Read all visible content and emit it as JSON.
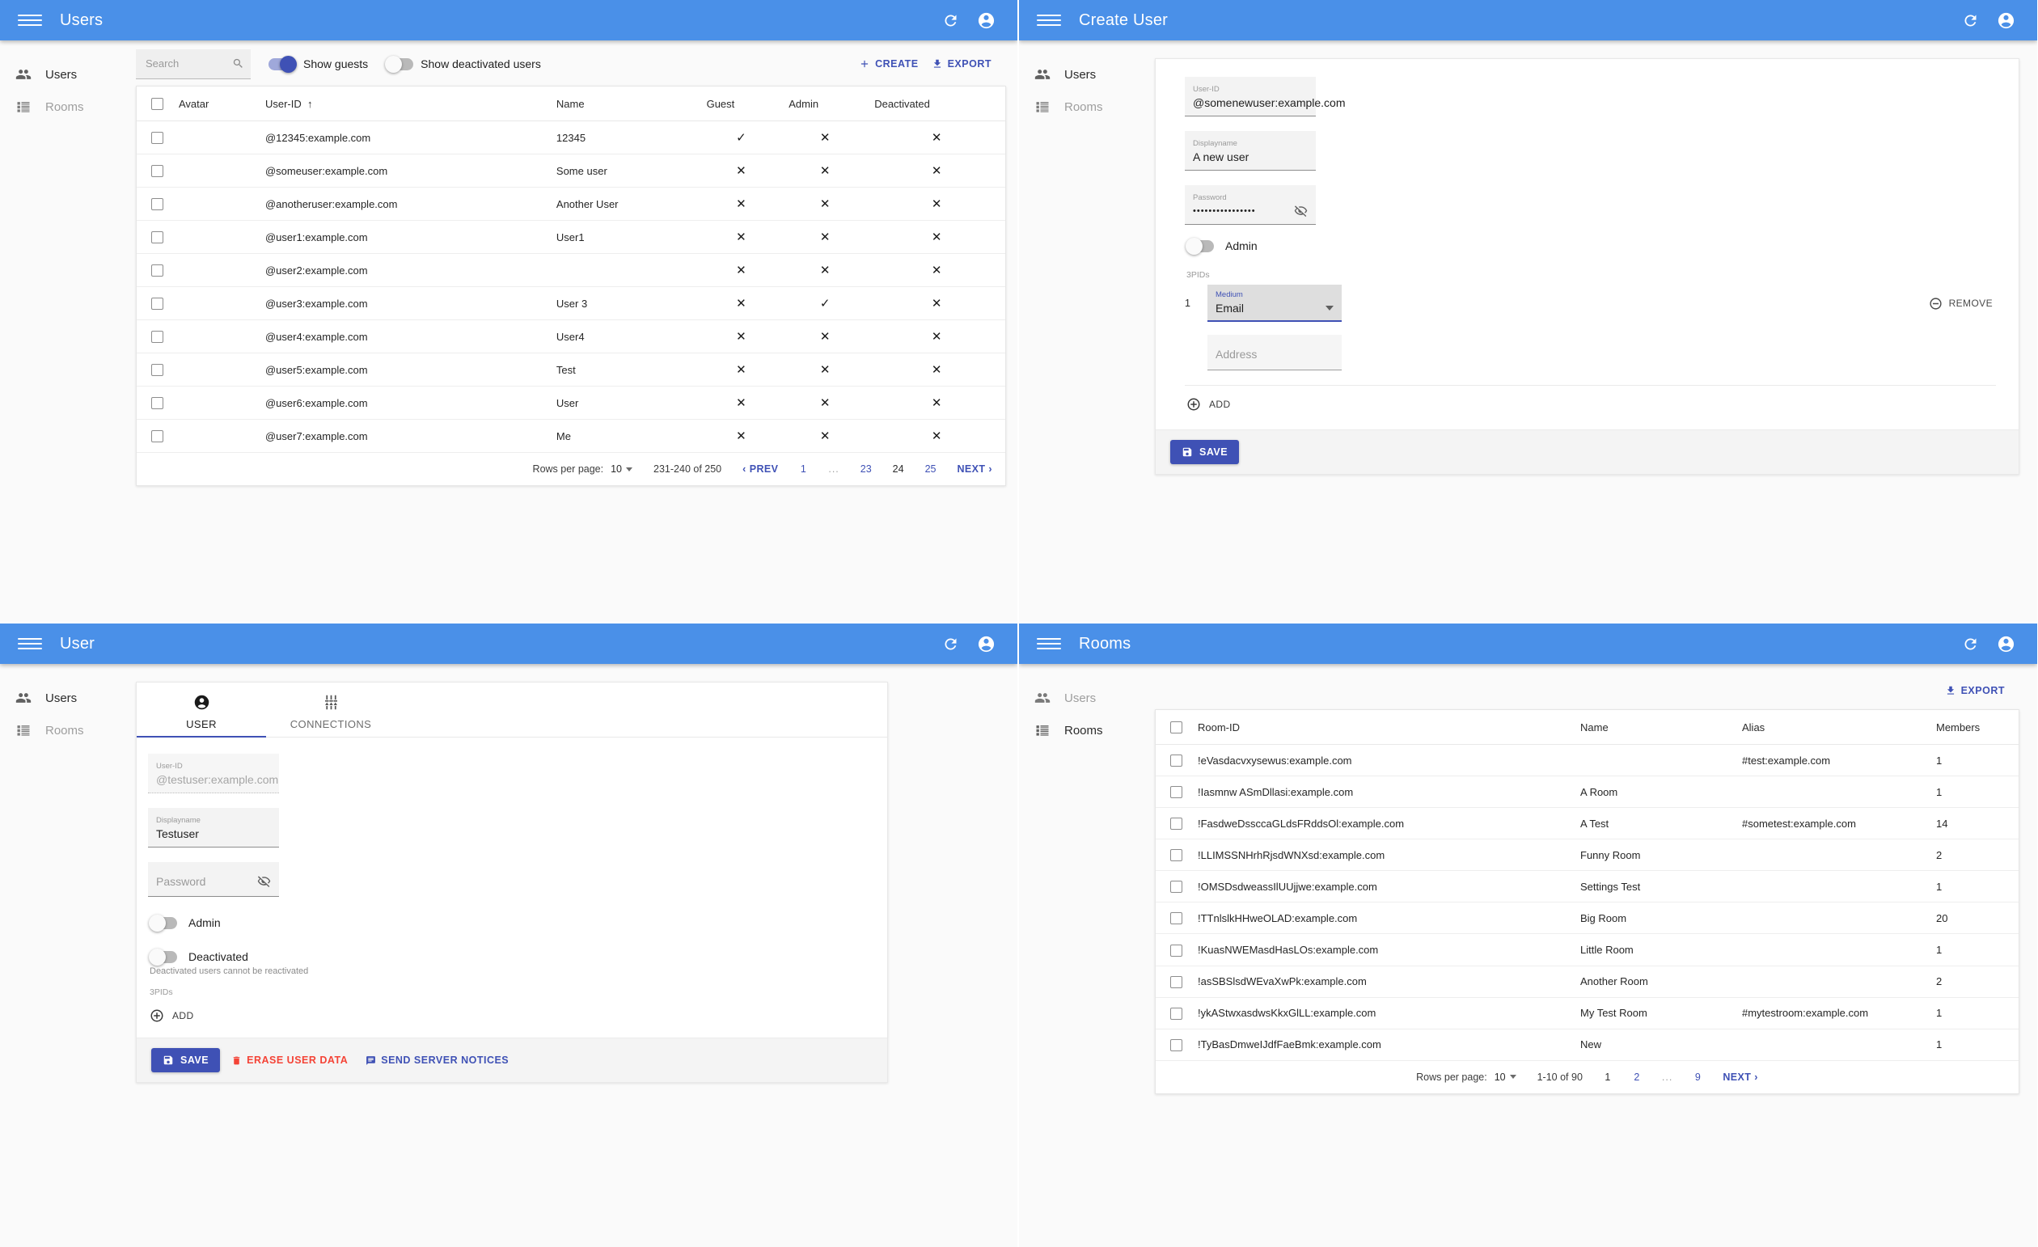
{
  "theme": {
    "appbar": "#4a90e8",
    "accent": "#3f51b5",
    "danger": "#f44336"
  },
  "panels": {
    "users_list": {
      "title": "Users",
      "sidebar": [
        {
          "label": "Users",
          "icon": "people-icon",
          "active": true
        },
        {
          "label": "Rooms",
          "icon": "list-icon",
          "active": false
        }
      ],
      "toolbar": {
        "search_placeholder": "Search",
        "search_value": "",
        "show_guests_label": "Show guests",
        "show_guests_on": true,
        "show_deactivated_label": "Show deactivated users",
        "show_deactivated_on": false,
        "create_label": "CREATE",
        "export_label": "EXPORT"
      },
      "table": {
        "columns": [
          "Avatar",
          "User-ID",
          "Name",
          "Guest",
          "Admin",
          "Deactivated"
        ],
        "sort_column": "User-ID",
        "sort_dir": "asc",
        "rows": [
          {
            "user_id": "@12345:example.com",
            "name": "12345",
            "guest": "check",
            "admin": "cross",
            "deactivated": "cross"
          },
          {
            "user_id": "@someuser:example.com",
            "name": "Some user",
            "guest": "cross",
            "admin": "cross",
            "deactivated": "cross"
          },
          {
            "user_id": "@anotheruser:example.com",
            "name": "Another User",
            "guest": "cross",
            "admin": "cross",
            "deactivated": "cross"
          },
          {
            "user_id": "@user1:example.com",
            "name": "User1",
            "guest": "cross",
            "admin": "cross",
            "deactivated": "cross"
          },
          {
            "user_id": "@user2:example.com",
            "name": "",
            "guest": "cross",
            "admin": "cross",
            "deactivated": "cross"
          },
          {
            "user_id": "@user3:example.com",
            "name": "User 3",
            "guest": "cross",
            "admin": "check",
            "deactivated": "cross"
          },
          {
            "user_id": "@user4:example.com",
            "name": "User4",
            "guest": "cross",
            "admin": "cross",
            "deactivated": "cross"
          },
          {
            "user_id": "@user5:example.com",
            "name": "Test",
            "guest": "cross",
            "admin": "cross",
            "deactivated": "cross"
          },
          {
            "user_id": "@user6:example.com",
            "name": "User",
            "guest": "cross",
            "admin": "cross",
            "deactivated": "cross"
          },
          {
            "user_id": "@user7:example.com",
            "name": "Me",
            "guest": "cross",
            "admin": "cross",
            "deactivated": "cross"
          }
        ]
      },
      "pagination": {
        "rows_per_page_label": "Rows per page:",
        "rows_per_page_value": "10",
        "range": "231-240 of 250",
        "prev_label": "PREV",
        "next_label": "NEXT",
        "pages": [
          {
            "label": "1",
            "current": false
          },
          {
            "label": "...",
            "current": false,
            "dots": true
          },
          {
            "label": "23",
            "current": false
          },
          {
            "label": "24",
            "current": true
          },
          {
            "label": "25",
            "current": false
          }
        ]
      }
    },
    "create_user": {
      "title": "Create User",
      "sidebar": [
        {
          "label": "Users",
          "icon": "people-icon",
          "active": true
        },
        {
          "label": "Rooms",
          "icon": "list-icon",
          "active": false
        }
      ],
      "form": {
        "user_id_label": "User-ID",
        "user_id_value": "@somenewuser:example.com",
        "displayname_label": "Displayname",
        "displayname_value": "A new user",
        "password_label": "Password",
        "password_value": "••••••••••••••••",
        "password_toggle_icon": "eye-off-icon",
        "admin_label": "Admin",
        "admin_on": false,
        "threepids_label": "3PIDs",
        "pid_index": "1",
        "medium_label": "Medium",
        "medium_value": "Email",
        "address_placeholder": "Address",
        "address_value": "",
        "remove_label": "REMOVE",
        "add_label": "ADD",
        "save_label": "SAVE"
      }
    },
    "user_detail": {
      "title": "User",
      "sidebar": [
        {
          "label": "Users",
          "icon": "people-icon",
          "active": true
        },
        {
          "label": "Rooms",
          "icon": "list-icon",
          "active": false
        }
      ],
      "tabs": [
        {
          "label": "USER",
          "icon": "account-icon",
          "active": true
        },
        {
          "label": "CONNECTIONS",
          "icon": "settings-sliders-icon",
          "active": false
        }
      ],
      "form": {
        "user_id_label": "User-ID",
        "user_id_value": "@testuser:example.com",
        "displayname_label": "Displayname",
        "displayname_value": "Testuser",
        "password_label": "Password",
        "password_value": "",
        "password_toggle_icon": "eye-off-icon",
        "admin_label": "Admin",
        "admin_on": false,
        "deactivated_label": "Deactivated",
        "deactivated_on": false,
        "deactivated_hint": "Deactivated users cannot be reactivated",
        "threepids_label": "3PIDs",
        "add_label": "ADD",
        "save_label": "SAVE",
        "erase_label": "ERASE USER DATA",
        "notices_label": "SEND SERVER NOTICES"
      }
    },
    "rooms_list": {
      "title": "Rooms",
      "sidebar": [
        {
          "label": "Users",
          "icon": "people-icon",
          "active": false
        },
        {
          "label": "Rooms",
          "icon": "list-icon",
          "active": true
        }
      ],
      "toolbar": {
        "export_label": "EXPORT"
      },
      "table": {
        "columns": [
          "Room-ID",
          "Name",
          "Alias",
          "Members"
        ],
        "rows": [
          {
            "room_id": "!eVasdacvxysewus:example.com",
            "name": "",
            "alias": "#test:example.com",
            "members": "1"
          },
          {
            "room_id": "!Iasmnw ASmDllasi:example.com",
            "name": "A Room",
            "alias": "",
            "members": "1"
          },
          {
            "room_id": "!FasdweDssccaGLdsFRddsOl:example.com",
            "name": "A Test",
            "alias": "#sometest:example.com",
            "members": "14"
          },
          {
            "room_id": "!LLIMSSNHrhRjsdWNXsd:example.com",
            "name": "Funny Room",
            "alias": "",
            "members": "2"
          },
          {
            "room_id": "!OMSDsdweassIlUUjjwe:example.com",
            "name": "Settings Test",
            "alias": "",
            "members": "1"
          },
          {
            "room_id": "!TTnlslkHHweOLAD:example.com",
            "name": "Big Room",
            "alias": "",
            "members": "20"
          },
          {
            "room_id": "!KuasNWEMasdHasLOs:example.com",
            "name": "Little Room",
            "alias": "",
            "members": "1"
          },
          {
            "room_id": "!asSBSlsdWEvaXwPk:example.com",
            "name": "Another Room",
            "alias": "",
            "members": "2"
          },
          {
            "room_id": "!ykAStwxasdwsKkxGlLL:example.com",
            "name": "My Test Room",
            "alias": "#mytestroom:example.com",
            "members": "1"
          },
          {
            "room_id": "!TyBasDmweIJdfFaeBmk:example.com",
            "name": "New",
            "alias": "",
            "members": "1"
          }
        ]
      },
      "pagination": {
        "rows_per_page_label": "Rows per page:",
        "rows_per_page_value": "10",
        "range": "1-10 of 90",
        "next_label": "NEXT",
        "pages": [
          {
            "label": "1",
            "current": true
          },
          {
            "label": "2",
            "current": false
          },
          {
            "label": "...",
            "current": false,
            "dots": true
          },
          {
            "label": "9",
            "current": false
          }
        ]
      }
    }
  },
  "icons": {
    "menu": "hamburger-icon",
    "refresh": "refresh-icon",
    "account": "account-circle-icon"
  }
}
